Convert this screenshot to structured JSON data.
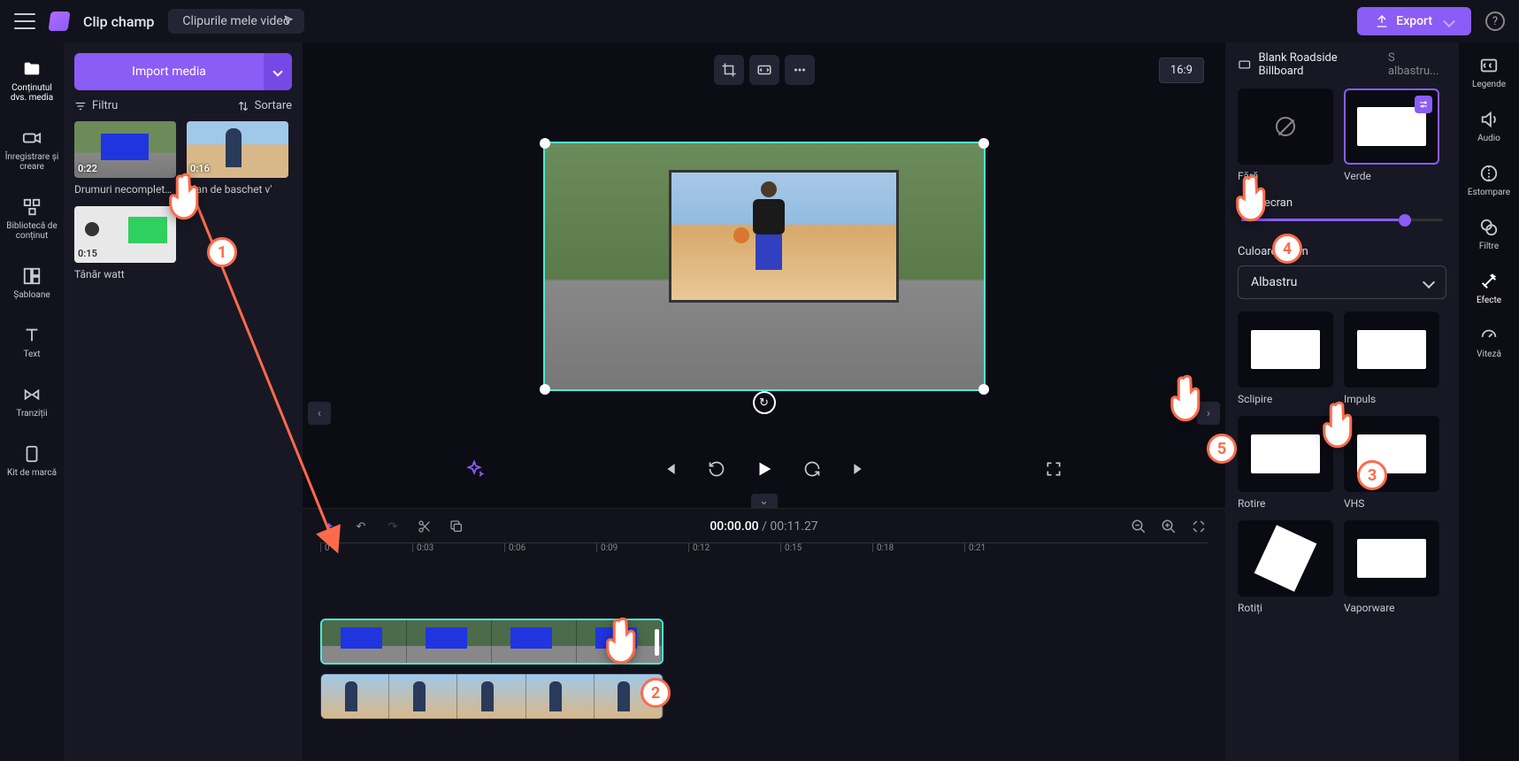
{
  "app": {
    "name": "Clip champ",
    "document_name": "Clipurile mele video"
  },
  "topbar": {
    "export": "Export"
  },
  "leftrail": {
    "media": "Conținutul dvs. media",
    "record": "Înregistrare și creare",
    "library": "Bibliotecă de conținut",
    "templates": "Șabloane",
    "text": "Text",
    "transitions": "Tranziții",
    "brandkit": "Kit de marcă"
  },
  "mediapanel": {
    "import": "Import media",
    "filter": "Filtru",
    "sort": "Sortare",
    "items": [
      {
        "title": "Drumuri necompletete",
        "duration": "0:22"
      },
      {
        "title": "Plan de baschet v'",
        "duration": "0:16"
      },
      {
        "title": "Tânăr watt",
        "duration": "0:15"
      }
    ]
  },
  "canvas": {
    "ratio": "16:9"
  },
  "playback": {
    "current": "00:00.00",
    "total": "00:11.27",
    "ruler": [
      "0",
      "0:03",
      "0:06",
      "0:09",
      "0:12",
      "0:15",
      "0:18",
      "0:21"
    ]
  },
  "rightpanel": {
    "breadcrumb1": "Blank Roadside Billboard",
    "breadcrumb2": "S albastru...",
    "none_label": "Fără",
    "green_label": "Verde",
    "threshold_label": "Prag ecran",
    "screencolor_label": "Culoare ecran",
    "screencolor_value": "Albastru",
    "effects": [
      {
        "name": "Sclipire"
      },
      {
        "name": "Impuls"
      },
      {
        "name": "Rotire"
      },
      {
        "name": "VHS"
      },
      {
        "name": "Rotiți"
      },
      {
        "name": "Vaporware"
      }
    ]
  },
  "rightrail": {
    "captions": "Legende",
    "audio": "Audio",
    "fade": "Estompare",
    "filters": "Filtre",
    "effects": "Efecte",
    "speed": "Viteză"
  },
  "callouts": {
    "n1": "1",
    "n2": "2",
    "n3": "3",
    "n4": "4",
    "n5": "5"
  }
}
